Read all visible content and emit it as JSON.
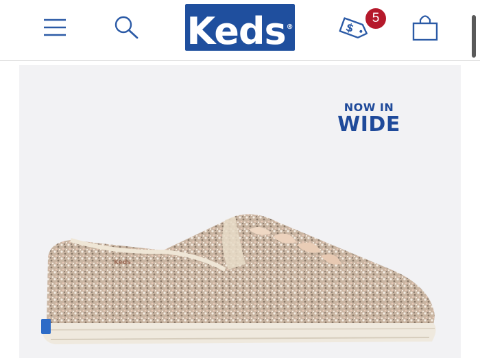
{
  "header": {
    "brand": "Keds",
    "brand_mark": "®",
    "cart_badge_count": "5",
    "icons": {
      "menu": "hamburger-menu-icon",
      "search": "search-icon",
      "offers": "price-tag-icon",
      "cart": "shopping-bag-icon"
    }
  },
  "hero": {
    "promo_line1": "NOW IN",
    "promo_line2": "WIDE",
    "shoe_brand_text": "Keds"
  },
  "colors": {
    "brand_blue": "#1f4f9e",
    "icon_blue": "#2b5aa6",
    "badge_red": "#b5192b",
    "hero_bg": "#f2f2f4"
  }
}
